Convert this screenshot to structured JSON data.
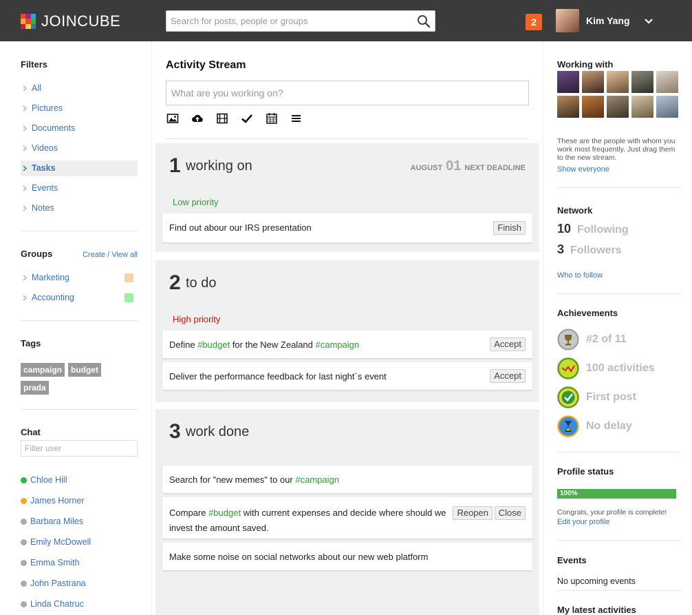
{
  "header": {
    "logo_text": "JOINCUBE",
    "search_placeholder": "Search for posts, people or groups",
    "notification_count": "2",
    "user_name": "Kim Yang"
  },
  "filters": {
    "title": "Filters",
    "items": [
      {
        "label": "All"
      },
      {
        "label": "Pictures"
      },
      {
        "label": "Documents"
      },
      {
        "label": "Videos"
      },
      {
        "label": "Tasks",
        "active": true
      },
      {
        "label": "Events"
      },
      {
        "label": "Notes"
      }
    ]
  },
  "groups": {
    "title": "Groups",
    "create_link": "Create / View all",
    "items": [
      {
        "label": "Marketing",
        "color": "#f9d3a4"
      },
      {
        "label": "Accounting",
        "color": "#99f0a0"
      }
    ]
  },
  "tags": {
    "title": "Tags",
    "items": [
      "campaign",
      "budget",
      "prada"
    ]
  },
  "chat": {
    "title": "Chat",
    "filter_placeholder": "Filter user",
    "users": [
      {
        "name": "Chloe Hill",
        "status_color": "#2db83d"
      },
      {
        "name": "James Horner",
        "status_color": "#f5a623"
      },
      {
        "name": "Barbara Miles",
        "status_color": "#aaaaaa"
      },
      {
        "name": "Emily McDowell",
        "status_color": "#aaaaaa"
      },
      {
        "name": "Emma Smith",
        "status_color": "#aaaaaa"
      },
      {
        "name": "John Pastrana",
        "status_color": "#aaaaaa"
      },
      {
        "name": "Linda Chatruc",
        "status_color": "#aaaaaa"
      }
    ]
  },
  "stream": {
    "title": "Activity Stream",
    "compose_placeholder": "What are you working on?",
    "working_on": {
      "num": "1",
      "label": "working on",
      "deadline_month": "AUGUST",
      "deadline_day": "01",
      "deadline_label": "NEXT DEADLINE",
      "priority": "Low priority",
      "tasks": [
        {
          "text": "Find out abour our IRS presentation",
          "button": "Finish"
        }
      ]
    },
    "todo": {
      "num": "2",
      "label": "to do",
      "priority": "High priority",
      "task1": {
        "pre": "Define ",
        "tag1": "#budget",
        "mid": " for the New Zealand ",
        "tag2": "#campaign",
        "button": "Accept"
      },
      "task2": {
        "text": "Deliver the performance feedback for last night´s event",
        "button": "Accept"
      }
    },
    "done": {
      "num": "3",
      "label": "work done",
      "task1": {
        "pre": "Search for \"new memes\" to our ",
        "tag": "#campaign"
      },
      "task2": {
        "pre": "Compare ",
        "tag": "#budget",
        "post": " with current expenses and decide where should we",
        "line2": "invest the amount saved.",
        "button1": "Reopen",
        "button2": "Close"
      },
      "task3": {
        "text": "Make some noise on social networks about our new web platform"
      }
    }
  },
  "working_with": {
    "title": "Working with",
    "hint": "These are the people with whom you work most frequently. Just drag them to the new stream.",
    "show_link": "Show everyone"
  },
  "network": {
    "title": "Network",
    "following_count": "10",
    "following_label": "Following",
    "followers_count": "3",
    "followers_label": "Followers",
    "who_link": "Who to follow"
  },
  "achievements": {
    "title": "Achievements",
    "items": [
      {
        "label": "#2 of 11",
        "icon": "trophy-icon"
      },
      {
        "label": "100 activities",
        "icon": "activity-icon"
      },
      {
        "label": "First post",
        "icon": "check-icon"
      },
      {
        "label": "No delay",
        "icon": "hourglass-icon"
      }
    ]
  },
  "profile": {
    "title": "Profile status",
    "percent_label": "100%",
    "percent": 100,
    "message": "Congrats, your profile is complete!",
    "edit_link": "Edit your profile"
  },
  "events": {
    "title": "Events",
    "message": "No upcoming events"
  },
  "latest": {
    "title": "My latest activities"
  }
}
